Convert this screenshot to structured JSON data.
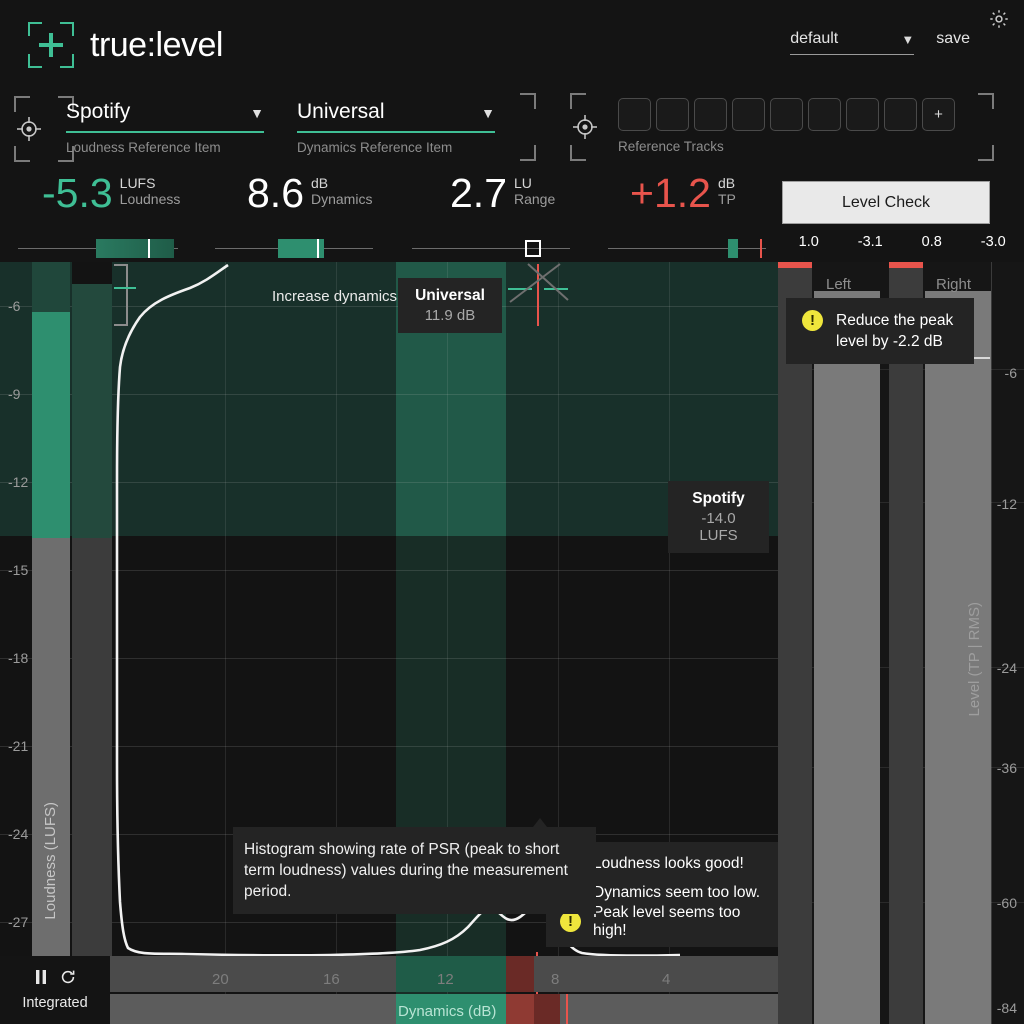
{
  "brand": {
    "name": "true:level",
    "logo_icon": "crosshair-plus-icon"
  },
  "header": {
    "preset": {
      "value": "default",
      "caret": "▼"
    },
    "save_label": "save",
    "settings_icon": "gear-icon"
  },
  "references": {
    "loudness": {
      "value": "Spotify",
      "label": "Loudness Reference Item",
      "caret": "▼",
      "icon": "target-icon"
    },
    "dynamics": {
      "value": "Universal",
      "label": "Dynamics Reference Item",
      "caret": "▼"
    },
    "tracks": {
      "label": "Reference Tracks",
      "add_label": "+",
      "slot_count": 8,
      "caret": "▼",
      "icon": "target-icon"
    }
  },
  "metrics": [
    {
      "value": "-5.3",
      "unit": "LUFS",
      "name": "Loudness",
      "accent": "#3fbf95"
    },
    {
      "value": "8.6",
      "unit": "dB",
      "name": "Dynamics",
      "accent": "#ffffff"
    },
    {
      "value": "2.7",
      "unit": "LU",
      "name": "Range",
      "accent": "#ffffff"
    },
    {
      "value": "+1.2",
      "unit": "dB",
      "name": "TP",
      "accent": "#e8544c"
    }
  ],
  "level_check": {
    "label": "Level Check"
  },
  "peak_values": [
    "1.0",
    "-3.1",
    "0.8",
    "-3.0"
  ],
  "meters": {
    "left_label": "Left",
    "right_label": "Right",
    "axis_label": "Level (TP | RMS)",
    "ticks": [
      "-6",
      "-12",
      "-24",
      "-36",
      "-60",
      "-84"
    ]
  },
  "chart_data": {
    "type": "histogram",
    "title": "",
    "xlabel": "Dynamics (dB)",
    "ylabel": "Loudness (LUFS)",
    "x_ticks": [
      "20",
      "16",
      "12",
      "8",
      "4"
    ],
    "y_ticks": [
      "-6",
      "-9",
      "-12",
      "-15",
      "-18",
      "-21",
      "-24",
      "-27"
    ],
    "ylim": [
      -28.5,
      -4.5
    ],
    "xlim": [
      22,
      2
    ],
    "grid": true,
    "series": [
      {
        "name": "PSR histogram",
        "color": "#ffffff"
      }
    ],
    "target_zone": {
      "dynamics_center": 11.9,
      "loudness_target": -14.0
    },
    "measured": {
      "loudness_lufs": -5.3,
      "dynamics_db": 8.6,
      "range_lu": 2.7,
      "true_peak_db": 1.2
    }
  },
  "annotations": {
    "increase_dynamics": "Increase dynamics",
    "universal_tip": {
      "title": "Universal",
      "value": "11.9 dB"
    },
    "spotify_tip": {
      "title": "Spotify",
      "value": "-14.0 LUFS"
    },
    "peak_warning": "Reduce the peak level by -2.2 dB",
    "histogram_tip": "Histogram showing rate of PSR (peak to short term loudness) values during the measurement period."
  },
  "status_messages": [
    {
      "text": "Loudness looks good!",
      "warn": false
    },
    {
      "text": "Dynamics seem too low.",
      "warn": true
    },
    {
      "text": "Peak level seems too high!",
      "warn": true
    }
  ],
  "transport": {
    "pause_icon": "pause-icon",
    "reset_icon": "reset-icon",
    "mode_label": "Integrated"
  },
  "colors": {
    "accent_green": "#3fbf95",
    "alert_red": "#e8544c",
    "warn_yellow": "#efe63c",
    "panel_bg": "#141414"
  }
}
